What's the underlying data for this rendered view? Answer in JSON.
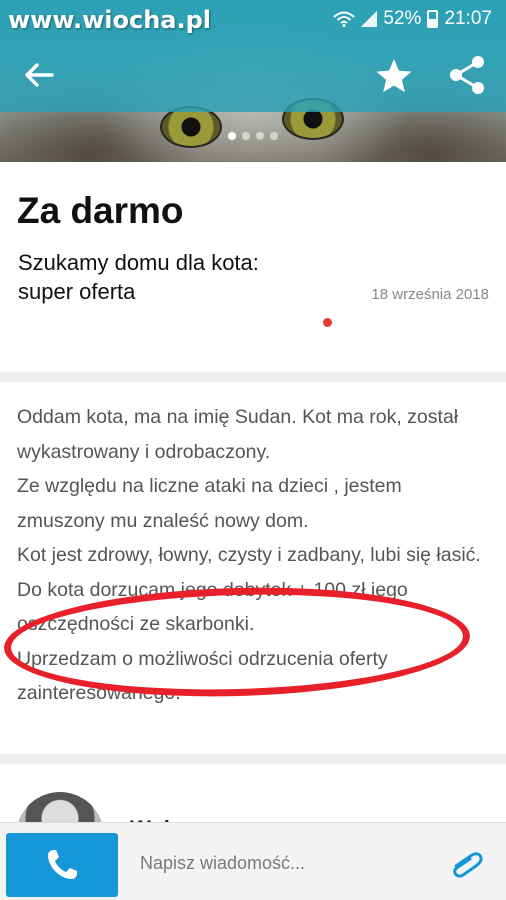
{
  "status_bar": {
    "watermark": "www.wiocha.pl",
    "battery": "52%",
    "time": "21:07"
  },
  "appbar": {
    "back_icon": "arrow-back-icon",
    "favorite_icon": "star-icon",
    "share_icon": "share-icon"
  },
  "gallery": {
    "count": 4,
    "active_index": 0
  },
  "listing": {
    "price": "Za darmo",
    "title": "Szukamy domu dla kota: super oferta",
    "date": "18 września 2018"
  },
  "description": {
    "p1": "Oddam kota, ma na imię Sudan. Kot ma rok, został wykastrowany i odrobaczony.",
    "p2": "Ze względu na liczne ataki na dzieci , jestem zmuszony mu znaleść nowy dom.",
    "p3": "Kot jest zdrowy, łowny, czysty i zadbany, lubi się łasić.",
    "p4": "Do kota dorzucam jego dobytek + 100 zł jego oszczędności ze skarbonki.",
    "p5": "Uprzedzam o możliwości odrzucenia oferty zainteresowanego."
  },
  "seller": {
    "name": "Wol..."
  },
  "bottom_bar": {
    "call_icon": "phone-icon",
    "message_placeholder": "Napisz wiadomość...",
    "attach_icon": "paperclip-icon"
  },
  "colors": {
    "accent": "#1597d8",
    "appbar": "#28a0b4",
    "highlight_circle": "#e8202a",
    "unread_dot": "#e53935"
  }
}
